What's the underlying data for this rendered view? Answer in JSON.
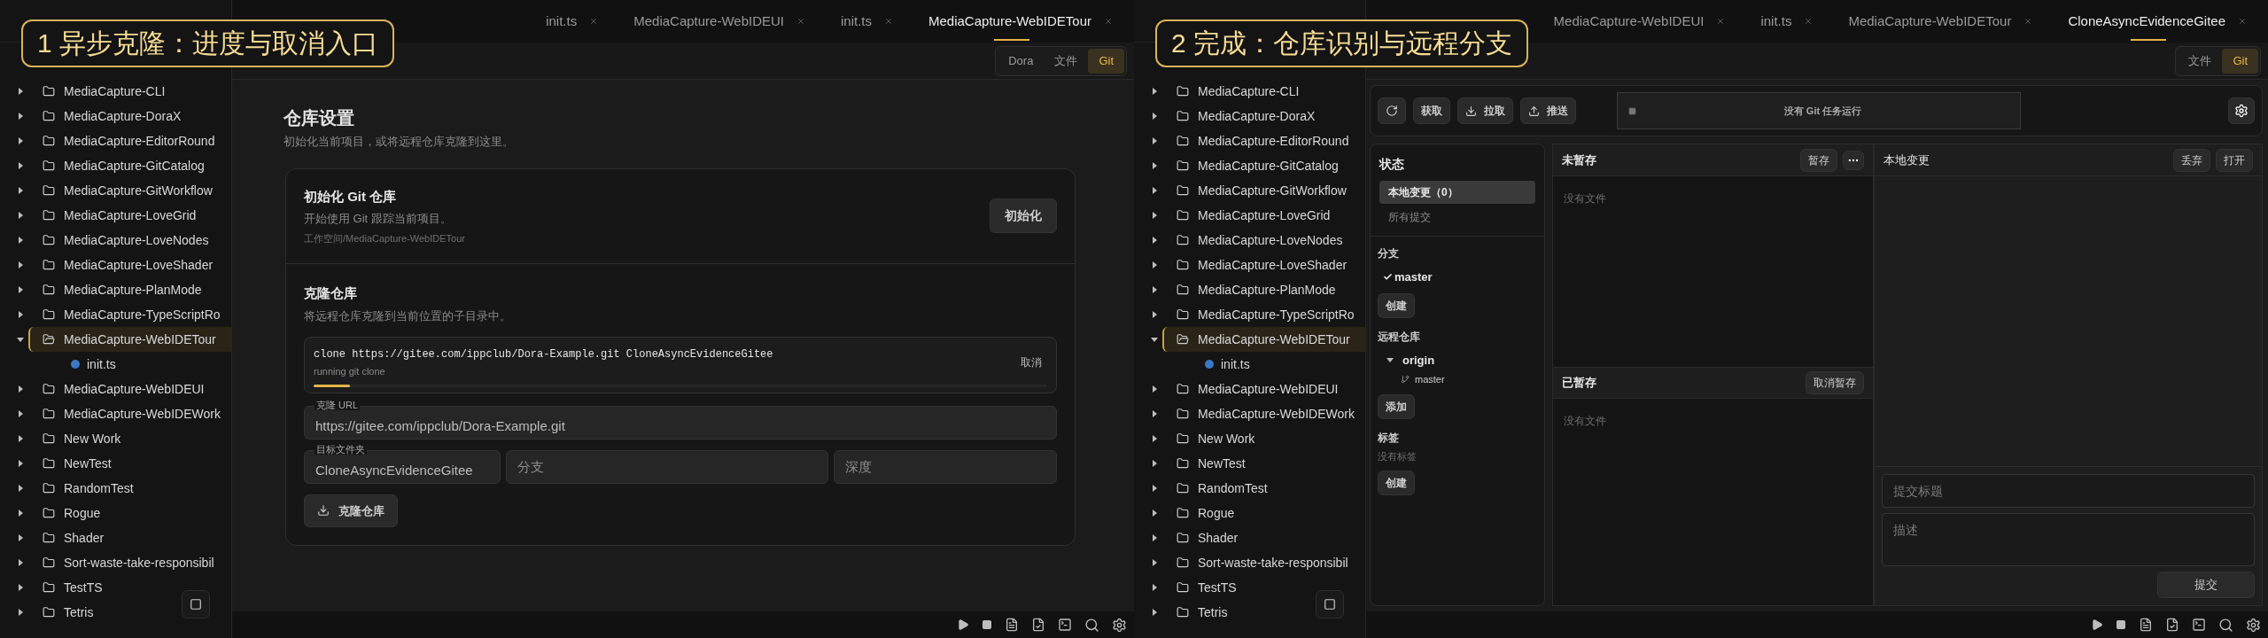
{
  "panels": [
    {
      "kind": "setup",
      "caption": "1 异步克隆：进度与取消入口",
      "tabs": [
        {
          "label": "init.ts",
          "selected": false
        },
        {
          "label": "MediaCapture-WebIDEUI",
          "selected": false
        },
        {
          "label": "init.ts",
          "selected": false
        },
        {
          "label": "MediaCapture-WebIDETour",
          "selected": true
        }
      ],
      "view_switch": [
        {
          "label": "Dora",
          "selected": false
        },
        {
          "label": "文件",
          "selected": false
        },
        {
          "label": "Git",
          "selected": true
        }
      ],
      "tree": [
        {
          "name": "MediaCapture-CLI",
          "expanded": false,
          "selected": false
        },
        {
          "name": "MediaCapture-DoraX",
          "expanded": false,
          "selected": false
        },
        {
          "name": "MediaCapture-EditorRound",
          "expanded": false,
          "selected": false
        },
        {
          "name": "MediaCapture-GitCatalog",
          "expanded": false,
          "selected": false
        },
        {
          "name": "MediaCapture-GitWorkflow",
          "expanded": false,
          "selected": false
        },
        {
          "name": "MediaCapture-LoveGrid",
          "expanded": false,
          "selected": false
        },
        {
          "name": "MediaCapture-LoveNodes",
          "expanded": false,
          "selected": false
        },
        {
          "name": "MediaCapture-LoveShader",
          "expanded": false,
          "selected": false
        },
        {
          "name": "MediaCapture-PlanMode",
          "expanded": false,
          "selected": false
        },
        {
          "name": "MediaCapture-TypeScriptRo",
          "expanded": false,
          "selected": false
        },
        {
          "name": "MediaCapture-WebIDETour",
          "expanded": true,
          "selected": true,
          "children": [
            {
              "name": "init.ts"
            }
          ]
        },
        {
          "name": "MediaCapture-WebIDEUI",
          "expanded": false,
          "selected": false
        },
        {
          "name": "MediaCapture-WebIDEWork",
          "expanded": false,
          "selected": false
        },
        {
          "name": "New Work",
          "expanded": false,
          "selected": false
        },
        {
          "name": "NewTest",
          "expanded": false,
          "selected": false
        },
        {
          "name": "RandomTest",
          "expanded": false,
          "selected": false
        },
        {
          "name": "Rogue",
          "expanded": false,
          "selected": false
        },
        {
          "name": "Shader",
          "expanded": false,
          "selected": false
        },
        {
          "name": "Sort-waste-take-responsibil",
          "expanded": false,
          "selected": false
        },
        {
          "name": "TestTS",
          "expanded": false,
          "selected": false
        },
        {
          "name": "Tetris",
          "expanded": false,
          "selected": false
        }
      ],
      "setup": {
        "title": "仓库设置",
        "subtitle": "初始化当前项目，或将远程仓库克隆到这里。",
        "init": {
          "title": "初始化 Git 仓库",
          "description": "开始使用 Git 跟踪当前项目。",
          "path": "工作空间/MediaCapture-WebIDETour",
          "button": "初始化"
        },
        "clone": {
          "title": "克隆仓库",
          "description": "将远程仓库克隆到当前位置的子目录中。",
          "task": {
            "command": "clone https://gitee.com/ippclub/Dora-Example.git CloneAsyncEvidenceGitee",
            "status": "running git clone",
            "level": 0.05,
            "cancel": "取消"
          },
          "url": {
            "label": "克隆 URL",
            "value": "https://gitee.com/ippclub/Dora-Example.git"
          },
          "folder": {
            "label": "目标文件夹",
            "value": "CloneAsyncEvidenceGitee"
          },
          "branch": {
            "placeholder": "分支"
          },
          "depth": {
            "placeholder": "深度"
          },
          "button": "克隆仓库"
        }
      }
    },
    {
      "kind": "git",
      "caption": "2 完成：仓库识别与远程分支",
      "tabs": [
        {
          "label": "MediaCapture-WebIDEUI",
          "selected": false
        },
        {
          "label": "init.ts",
          "selected": false
        },
        {
          "label": "MediaCapture-WebIDETour",
          "selected": false
        },
        {
          "label": "CloneAsyncEvidenceGitee",
          "selected": true
        }
      ],
      "view_switch": [
        {
          "label": "文件",
          "selected": false
        },
        {
          "label": "Git",
          "selected": true
        }
      ],
      "tree": [
        {
          "name": "MediaCapture-CLI",
          "expanded": false,
          "selected": false
        },
        {
          "name": "MediaCapture-DoraX",
          "expanded": false,
          "selected": false
        },
        {
          "name": "MediaCapture-EditorRound",
          "expanded": false,
          "selected": false
        },
        {
          "name": "MediaCapture-GitCatalog",
          "expanded": false,
          "selected": false
        },
        {
          "name": "MediaCapture-GitWorkflow",
          "expanded": false,
          "selected": false
        },
        {
          "name": "MediaCapture-LoveGrid",
          "expanded": false,
          "selected": false
        },
        {
          "name": "MediaCapture-LoveNodes",
          "expanded": false,
          "selected": false
        },
        {
          "name": "MediaCapture-LoveShader",
          "expanded": false,
          "selected": false
        },
        {
          "name": "MediaCapture-PlanMode",
          "expanded": false,
          "selected": false
        },
        {
          "name": "MediaCapture-TypeScriptRo",
          "expanded": false,
          "selected": false
        },
        {
          "name": "MediaCapture-WebIDETour",
          "expanded": true,
          "selected": true,
          "children": [
            {
              "name": "init.ts"
            }
          ]
        },
        {
          "name": "MediaCapture-WebIDEUI",
          "expanded": false,
          "selected": false
        },
        {
          "name": "MediaCapture-WebIDEWork",
          "expanded": false,
          "selected": false
        },
        {
          "name": "New Work",
          "expanded": false,
          "selected": false
        },
        {
          "name": "NewTest",
          "expanded": false,
          "selected": false
        },
        {
          "name": "RandomTest",
          "expanded": false,
          "selected": false
        },
        {
          "name": "Rogue",
          "expanded": false,
          "selected": false
        },
        {
          "name": "Shader",
          "expanded": false,
          "selected": false
        },
        {
          "name": "Sort-waste-take-responsibil",
          "expanded": false,
          "selected": false
        },
        {
          "name": "TestTS",
          "expanded": false,
          "selected": false
        },
        {
          "name": "Tetris",
          "expanded": false,
          "selected": false
        }
      ],
      "git": {
        "actions": [
          {
            "kind": "refresh"
          },
          {
            "kind": "plain",
            "label": "获取"
          },
          {
            "kind": "download",
            "label": "拉取"
          },
          {
            "kind": "upload",
            "label": "推送"
          }
        ],
        "task_status": "没有 Git 任务运行",
        "status": {
          "title": "状态",
          "views": [
            {
              "label": "本地变更（0）",
              "selected": true
            },
            {
              "label": "所有提交",
              "selected": false
            }
          ]
        },
        "branches": {
          "title": "分支",
          "items": [
            {
              "name": "master",
              "current": true
            }
          ],
          "button": "创建"
        },
        "remotes": {
          "title": "远程仓库",
          "items": [
            {
              "name": "origin",
              "expanded": true,
              "children": [
                {
                  "name": "master"
                }
              ]
            }
          ],
          "button": "添加"
        },
        "tags": {
          "title": "标签",
          "empty": "没有标签",
          "button": "创建"
        },
        "unstaged": {
          "title": "未暂存",
          "button": "暂存",
          "empty": "没有文件"
        },
        "staged": {
          "title": "已暂存",
          "button": "取消暂存",
          "empty": "没有文件"
        },
        "changes": {
          "title": "本地变更",
          "buttons": [
            "丢弃",
            "打开"
          ]
        },
        "commit": {
          "title_placeholder": "提交标题",
          "description_placeholder": "描述",
          "button": "提交"
        }
      }
    }
  ]
}
